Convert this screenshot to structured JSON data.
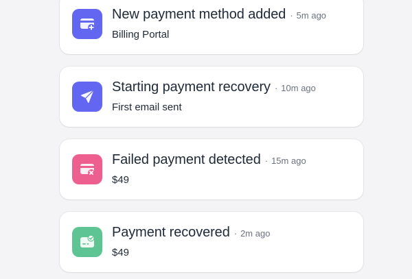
{
  "colors": {
    "page_background": "#f4f4f6",
    "card_background": "#ffffff",
    "indigo_icon_tile": "#6366f1",
    "pink_icon_tile": "#ec5f8f",
    "green_icon_tile": "#5fc493"
  },
  "separator": "·",
  "events": [
    {
      "icon": "card-plus-icon",
      "title": "New payment method added",
      "time": "5m ago",
      "detail": "Billing Portal"
    },
    {
      "icon": "paper-plane-icon",
      "title": "Starting payment recovery",
      "time": "10m ago",
      "detail": "First email sent"
    },
    {
      "icon": "card-x-icon",
      "title": "Failed payment detected",
      "time": "15m ago",
      "detail": "$49"
    },
    {
      "icon": "card-check-icon",
      "title": "Payment recovered",
      "time": "2m ago",
      "detail": "$49"
    }
  ]
}
